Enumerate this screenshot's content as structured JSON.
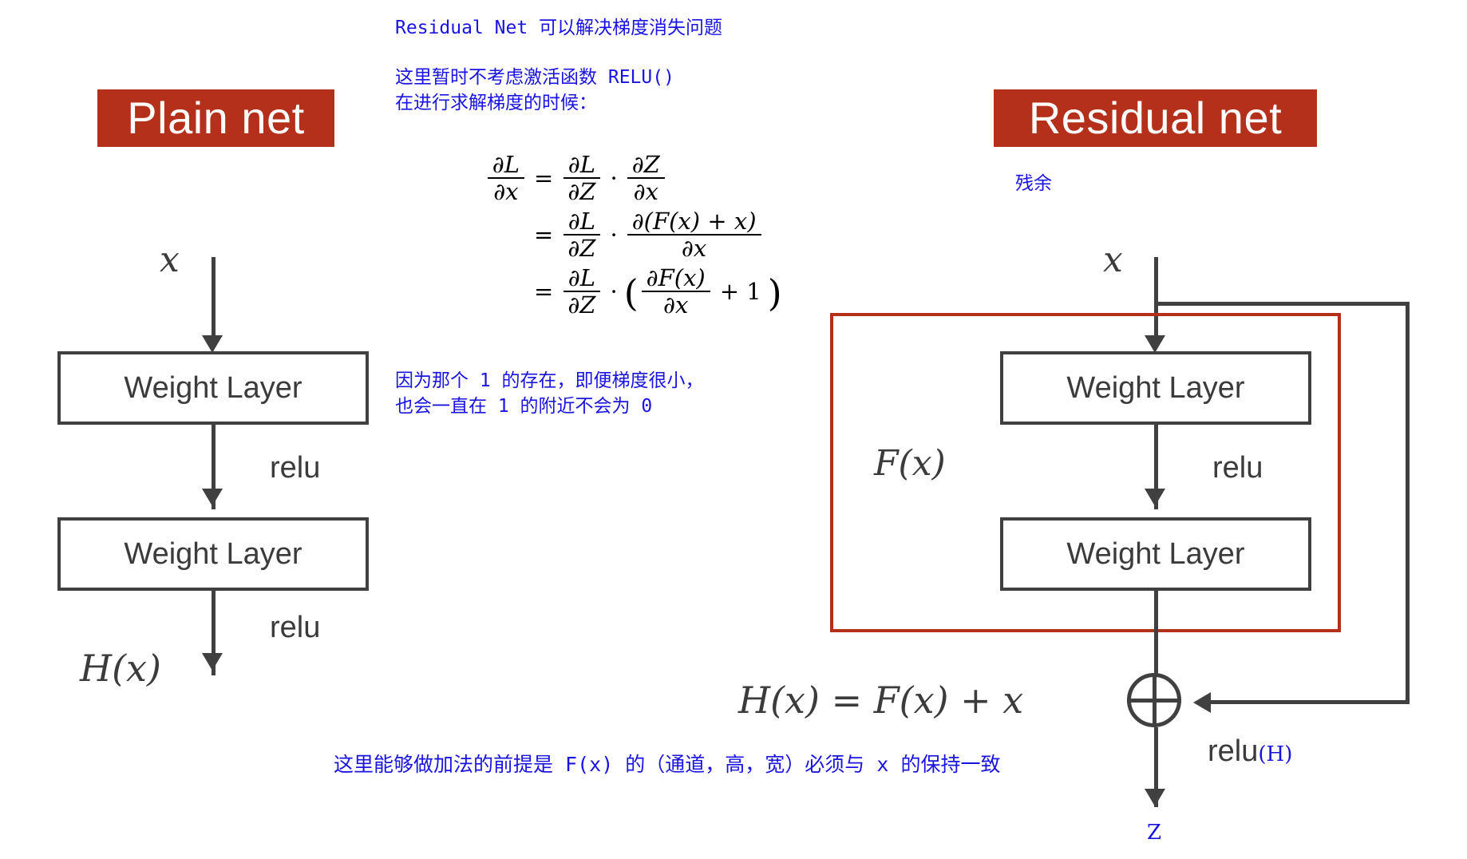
{
  "page": {
    "background": "#ffffff",
    "accent_red": "#B5301A",
    "annotation_blue": "#1a14e0",
    "line_gray": "#404040"
  },
  "left_panel": {
    "title": "Plain net",
    "input_label": "x",
    "block1_label": "Weight Layer",
    "relu1_label": "relu",
    "block2_label": "Weight Layer",
    "relu2_label": "relu",
    "output_label": "H(x)"
  },
  "right_panel": {
    "title": "Residual net",
    "subtitle_cn": "残余",
    "input_label": "x",
    "fx_label": "F(x)",
    "block1_label": "Weight Layer",
    "relu1_label": "relu",
    "block2_label": "Weight Layer",
    "sum_equation": "H(x) = F(x) + x",
    "sum_node_icon": "plus-circle-icon",
    "relu_out_label": "relu",
    "relu_out_sub": "(H)",
    "output_label": "Z"
  },
  "notes": {
    "heading": "Residual Net 可以解决梯度消失问题",
    "premise_line1": "这里暂时不考虑激活函数 RELU()",
    "premise_line2": "在进行求解梯度的时候：",
    "conclusion_line1": "因为那个 1 的存在，即便梯度很小，",
    "conclusion_line2": "也会一直在 1 的附近不会为 0",
    "bottom_note": "这里能够做加法的前提是 F(x) 的（通道，高，宽）必须与 x 的保持一致"
  },
  "equations": {
    "line1": {
      "lhs_num": "∂L",
      "lhs_den": "∂x",
      "eq": "=",
      "t1_num": "∂L",
      "t1_den": "∂Z",
      "dot": "·",
      "t2_num": "∂Z",
      "t2_den": "∂x"
    },
    "line2": {
      "eq": "=",
      "t1_num": "∂L",
      "t1_den": "∂Z",
      "dot": "·",
      "t2_num": "∂(F(x) + x)",
      "t2_den": "∂x"
    },
    "line3": {
      "eq": "=",
      "t1_num": "∂L",
      "t1_den": "∂Z",
      "dot": "·",
      "open_paren": "(",
      "t2_num": "∂F(x)",
      "t2_den": "∂x",
      "plus_one": "+ 1",
      "close_paren": ")"
    }
  }
}
